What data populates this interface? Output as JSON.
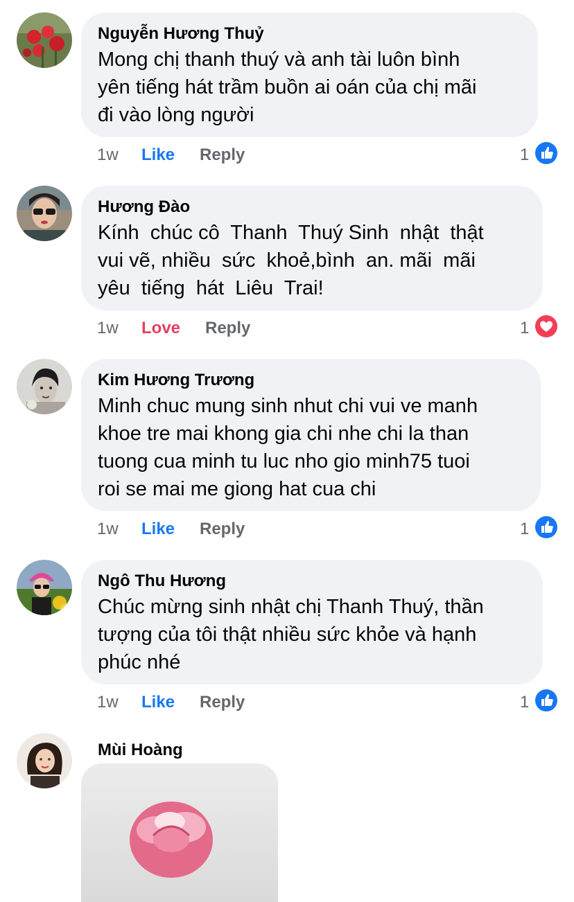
{
  "colors": {
    "bubble": "#f0f2f5",
    "meta_gray": "#65676b",
    "like_blue": "#1877f2",
    "love_red": "#e4405f"
  },
  "comments": [
    {
      "author": "Nguyễn Hương Thuỷ",
      "text": "Mong chị thanh thuý và anh tài luôn bình\nyên tiếng hát trầm buồn ai oán của chị mãi\nđi vào lòng người",
      "time": "1w",
      "reaction_label": "Like",
      "reply_label": "Reply",
      "reaction_count": "1",
      "reaction_icon": "like-icon"
    },
    {
      "author": "Hương Đào",
      "text": "Kính  chúc cô  Thanh  Thuý Sinh  nhật  thật\nvui vẽ, nhiều  sức  khoẻ,bình  an. mãi  mãi\nyêu  tiếng  hát  Liêu  Trai!",
      "time": "1w",
      "reaction_label": "Love",
      "reply_label": "Reply",
      "reaction_count": "1",
      "reaction_icon": "love-icon"
    },
    {
      "author": "Kim Hương Trương",
      "text": "Minh chuc mung sinh nhut chi vui ve manh\nkhoe tre mai khong gia chi nhe chi la than\ntuong cua minh tu luc nho gio minh75 tuoi\nroi se mai me giong hat cua chi",
      "time": "1w",
      "reaction_label": "Like",
      "reply_label": "Reply",
      "reaction_count": "1",
      "reaction_icon": "like-icon"
    },
    {
      "author": "Ngô Thu Hương",
      "text": "Chúc mừng sinh nhật chị Thanh Thuý, thần\ntượng của tôi thật nhiều sức khỏe và hạnh\nphúc nhé",
      "time": "1w",
      "reaction_label": "Like",
      "reply_label": "Reply",
      "reaction_count": "1",
      "reaction_icon": "like-icon"
    },
    {
      "author": "Mùi Hoàng",
      "attachment_icon": "rose-photo"
    }
  ]
}
